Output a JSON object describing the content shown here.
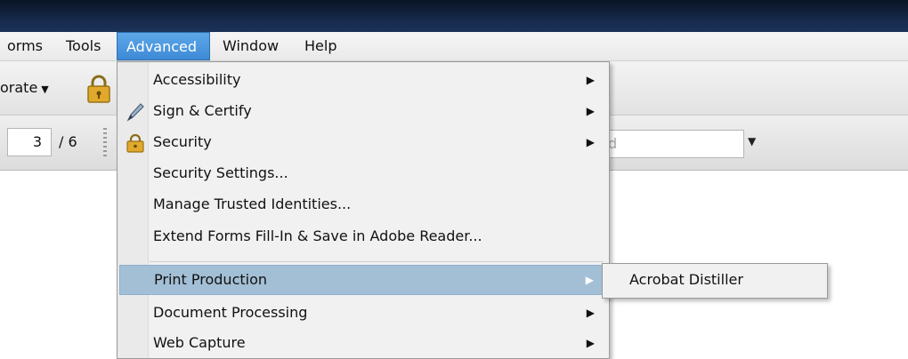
{
  "menubar": {
    "items": [
      {
        "id": "forms",
        "label": "orms"
      },
      {
        "id": "tools",
        "label": "Tools"
      },
      {
        "id": "advanced",
        "label": "Advanced"
      },
      {
        "id": "window",
        "label": "Window"
      },
      {
        "id": "help",
        "label": "Help"
      }
    ]
  },
  "toolbar": {
    "collaborate_label": "orate",
    "page_number": "3",
    "page_total": "/ 6",
    "find_placeholder": "d"
  },
  "advanced_menu": {
    "items": [
      {
        "label": "Accessibility",
        "icon": "",
        "has_submenu": true
      },
      {
        "label": "Sign & Certify",
        "icon": "pen-icon",
        "has_submenu": true
      },
      {
        "label": "Security",
        "icon": "lock-icon",
        "has_submenu": true
      },
      {
        "label": "Security Settings...",
        "icon": "",
        "has_submenu": false
      },
      {
        "label": "Manage Trusted Identities...",
        "icon": "",
        "has_submenu": false
      },
      {
        "label": "Extend Forms Fill-In & Save in Adobe Reader...",
        "icon": "",
        "has_submenu": false
      },
      {
        "label": "Print Production",
        "icon": "",
        "has_submenu": true,
        "highlighted": true
      },
      {
        "label": "Document Processing",
        "icon": "",
        "has_submenu": true
      },
      {
        "label": "Web Capture",
        "icon": "",
        "has_submenu": true
      }
    ]
  },
  "print_production_submenu": {
    "items": [
      {
        "label": "Acrobat Distiller"
      }
    ]
  },
  "colors": {
    "highlight": "#a3bfd6",
    "active_menu": "#3f8ad6",
    "titlebar": "#16294a"
  }
}
